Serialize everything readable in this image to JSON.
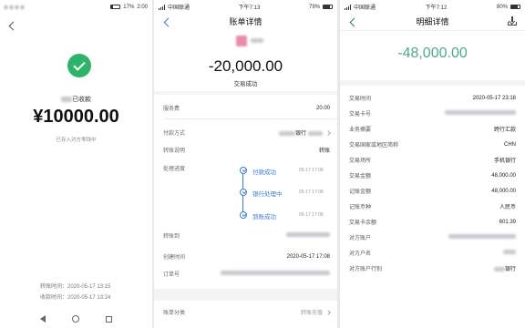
{
  "p1": {
    "status": {
      "left_icons": "notification-icons",
      "right": "17%",
      "time": "2:00"
    },
    "received_suffix": "已收款",
    "amount": "¥10000.00",
    "note": "已存入对方零钱中",
    "transfer_time": "转账时间：2020-05-17 13:15",
    "receive_time": "收款时间：2020-05-17 13:24"
  },
  "p2": {
    "status": {
      "carrier": "中国联通",
      "time": "下午7:13",
      "battery": "79%"
    },
    "title": "账单详情",
    "amount": "-20,000.00",
    "status_text": "交易成功",
    "rows": {
      "fee_label": "服务费",
      "fee_value": "20.00",
      "pay_label": "付款方式",
      "pay_value": "银行",
      "desc_label": "转账说明",
      "desc_value": "转账",
      "progress_label": "处理进度",
      "transfer_to_label": "转账到",
      "created_label": "创建时间",
      "created_value": "2020-05-17 17:08",
      "order_label": "订单号",
      "category_label": "账单分类",
      "category_value": "转账充值"
    },
    "timeline": [
      {
        "label": "付款成功",
        "time": "05-17 17:08"
      },
      {
        "label": "银行处理中",
        "time": "05-17 17:08"
      },
      {
        "label": "到账成功",
        "time": "05-17 17:08"
      }
    ]
  },
  "p3": {
    "status": {
      "carrier": "中国联通",
      "time": "下午7:12",
      "battery": "80%"
    },
    "title": "明细详情",
    "amount": "-48,000.00",
    "rows": [
      {
        "label": "交易时间",
        "value": "2020-05-17 23:18"
      },
      {
        "label": "交易卡号",
        "value": ""
      },
      {
        "label": "业务摘要",
        "value": "跨行汇款"
      },
      {
        "label": "交易国家或地区简称",
        "value": "CHN"
      },
      {
        "label": "交易场所",
        "value": "手机银行"
      },
      {
        "label": "交易金额",
        "value": "48,000.00"
      },
      {
        "label": "记账金额",
        "value": "48,000.00"
      },
      {
        "label": "记账币种",
        "value": "人民币"
      },
      {
        "label": "交易卡余额",
        "value": "601.39"
      },
      {
        "label": "对方账户",
        "value": ""
      },
      {
        "label": "对方户名",
        "value": ""
      },
      {
        "label": "对方账户行别",
        "value": "银行"
      }
    ]
  }
}
